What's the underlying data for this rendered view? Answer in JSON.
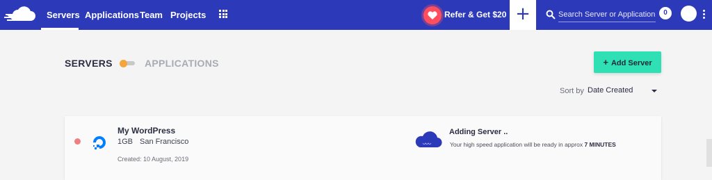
{
  "nav": {
    "links": [
      "Servers",
      "Applications",
      "Team",
      "Projects"
    ],
    "active": "Servers",
    "refer_label": "Refer & Get $20",
    "plus_label": "+",
    "search_placeholder": "Search Server or Application",
    "notification_count": "0"
  },
  "tabs": {
    "servers_label": "SERVERS",
    "applications_label": "APPLICATIONS"
  },
  "toolbar": {
    "add_server_label": "Add Server",
    "sort_by_label": "Sort by",
    "sort_by_value": "Date Created"
  },
  "server": {
    "name": "My WordPress",
    "size": "1GB",
    "location": "San Francisco",
    "created": "Created: 10 August, 2019",
    "status_title": "Adding Server ..",
    "status_desc_prefix": "Your high speed application will be ready in approx ",
    "status_desc_time": "7 MINUTES"
  },
  "colors": {
    "topbar": "#2c39b9",
    "accent_add": "#2ee0b4",
    "refer_badge": "#ff4f5e",
    "status_dot": "#f08080",
    "toggle_knob": "#f3a63b"
  },
  "icons": [
    "cloudways-logo-icon",
    "apps-grid-icon",
    "heart-icon",
    "plus-icon",
    "search-icon",
    "avatar-icon",
    "kebab-menu-icon",
    "digitalocean-icon",
    "cloud-icon",
    "caret-down-icon"
  ]
}
